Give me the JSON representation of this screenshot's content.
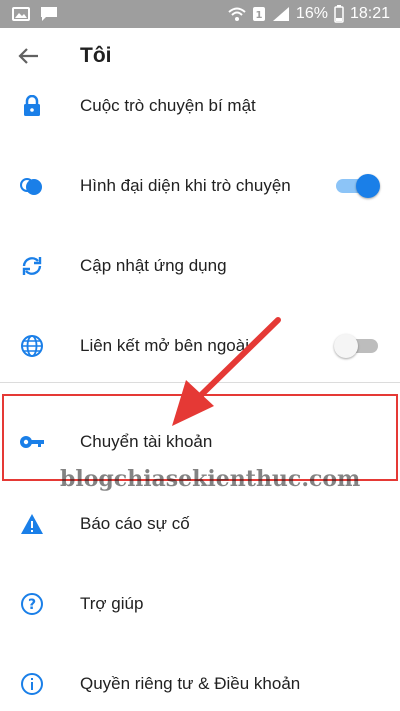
{
  "status_bar": {
    "battery": "16%",
    "time": "18:21"
  },
  "app_bar": {
    "title": "Tôi",
    "back_icon": "arrow-left-icon"
  },
  "settings": [
    {
      "label": "Cuộc trò chuyện bí mật",
      "icon": "lock-icon"
    },
    {
      "label": "Hình đại diện khi trò chuyện",
      "icon": "chat-heads-icon",
      "toggle": true
    },
    {
      "label": "Cập nhật ứng dụng",
      "icon": "sync-icon"
    },
    {
      "label": "Liên kết mở bên ngoài",
      "icon": "globe-icon",
      "toggle": false
    },
    {
      "label": "Chuyển tài khoản",
      "icon": "key-icon"
    },
    {
      "label": "Báo cáo sự cố",
      "icon": "warning-icon"
    },
    {
      "label": "Trợ giúp",
      "icon": "help-icon"
    },
    {
      "label": "Quyền riêng tư & Điều khoản",
      "icon": "info-icon"
    }
  ],
  "annotation": {
    "watermark": "blogchiasekienthuc.com",
    "arrow_color": "#e53935"
  },
  "colors": {
    "accent": "#1a7fe8",
    "status_bar": "#9e9e9e"
  }
}
